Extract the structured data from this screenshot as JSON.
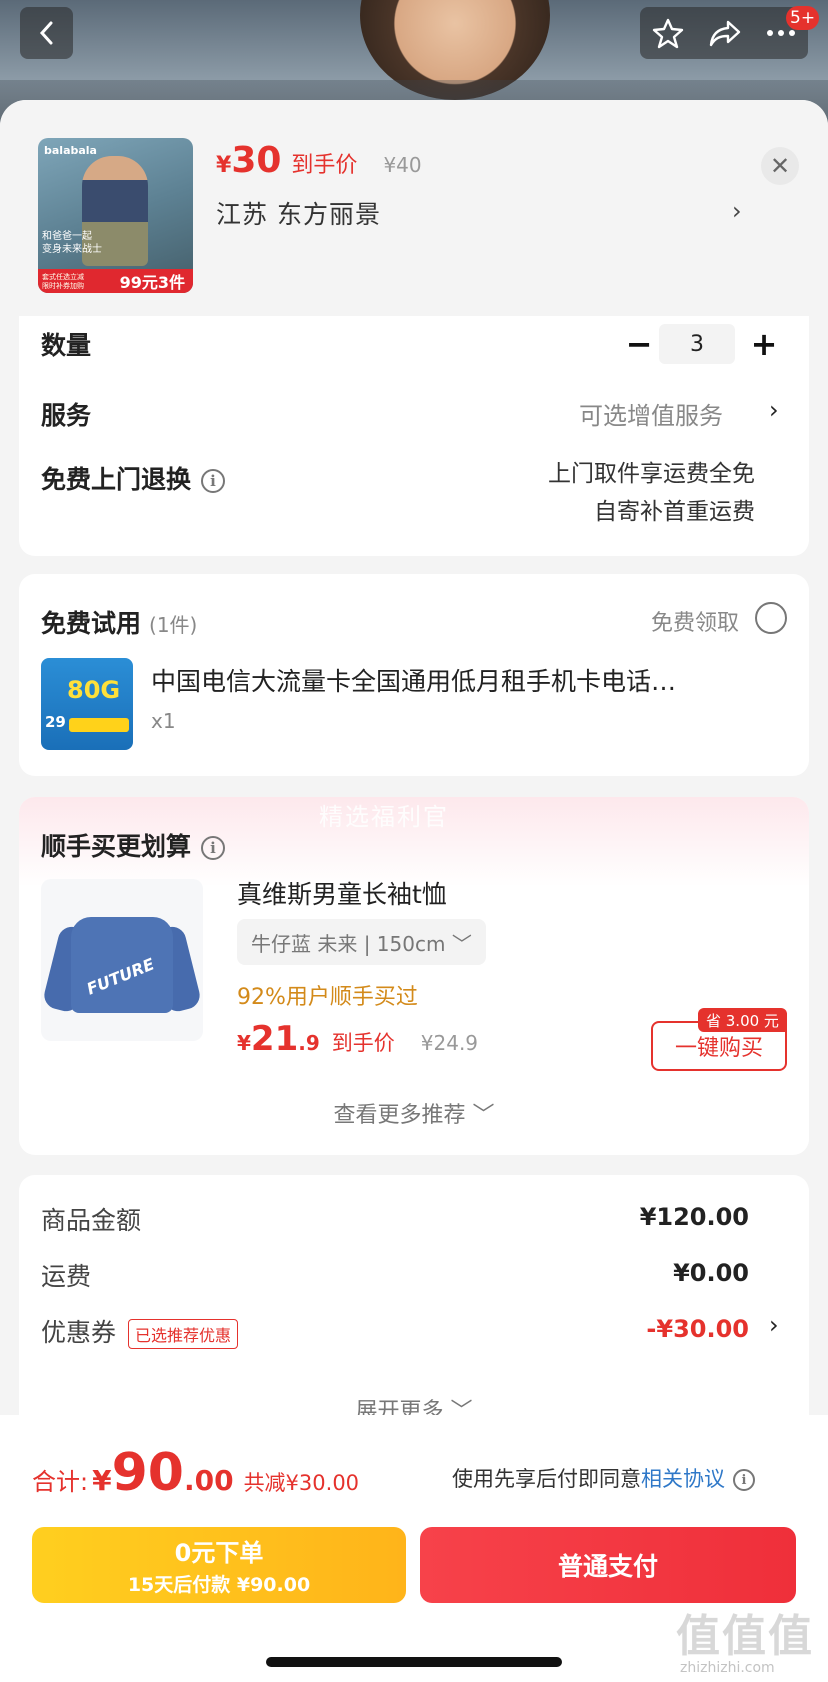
{
  "topbar": {
    "back_icon": "chevron-left-icon",
    "star_icon": "star-icon",
    "share_icon": "share-icon",
    "more_icon": "more-icon",
    "badge": "5+"
  },
  "product": {
    "thumb_brand": "balabala",
    "thumb_tagline": "和爸爸一起\n变身未来战士",
    "thumb_promo": "99元3件",
    "thumb_promo_left": "套式任选立减\n限时补券加购",
    "price_symbol": "¥",
    "price": "30",
    "price_label": "到手价",
    "orig_price": "¥40",
    "address": "江苏  东方丽景",
    "address_arrow": "›",
    "close": "✕"
  },
  "options": {
    "qty_label": "数量",
    "qty_minus": "−",
    "qty_value": "3",
    "qty_plus": "+",
    "service_label": "服务",
    "service_value": "可选增值服务",
    "service_arrow": "›",
    "return_label": "免费上门退换",
    "info_glyph": "i",
    "return_line1": "上门取件享运费全免",
    "return_line2": "自寄补首重运费"
  },
  "trial": {
    "title": "免费试用",
    "count": "(1件)",
    "get_label": "免费领取",
    "sim_80g": "80G",
    "sim_29": "29",
    "item_title": "中国电信大流量卡全国通用低月租手机卡电话…",
    "item_qty": "x1"
  },
  "bundle": {
    "banner": "精选福利官",
    "title": "顺手买更划算",
    "shirt_text": "FUTURE",
    "item_title": "真维斯男童长袖t恤",
    "sku": "牛仔蓝 未来  |  150cm ﹀",
    "social": "92%用户顺手买过",
    "price_symbol": "¥",
    "price_big": "21",
    "price_decimal": ".9",
    "price_label": "到手价",
    "orig_price": "¥24.9",
    "save_tag": "省 3.00 元",
    "buy_button": "一键购买",
    "more": "查看更多推荐 ﹀"
  },
  "summary": {
    "goods_label": "商品金额",
    "goods_value": "¥120.00",
    "ship_label": "运费",
    "ship_value": "¥0.00",
    "coupon_label": "优惠券",
    "coupon_tag": "已选推荐优惠",
    "coupon_value": "-¥30.00",
    "coupon_arrow": "›",
    "expand": "展开更多 ﹀"
  },
  "footer": {
    "total_label": "合计:",
    "total_symbol": "¥",
    "total_big": "90",
    "total_decimal": ".00",
    "saved": "共减¥30.00",
    "agree_prefix": "使用先享后付即同意",
    "agree_link": "相关协议",
    "later_line1": "0元下单",
    "later_line2": "15天后付款 ¥90.00",
    "pay_button": "普通支付",
    "watermark": "值值值",
    "watermark_small": "zhizhizhi.com"
  },
  "colors": {
    "accent_red": "#e5322d",
    "later_yellow": "#ffc21d",
    "link_blue": "#2f78c8",
    "social_orange": "#d38a1a"
  }
}
